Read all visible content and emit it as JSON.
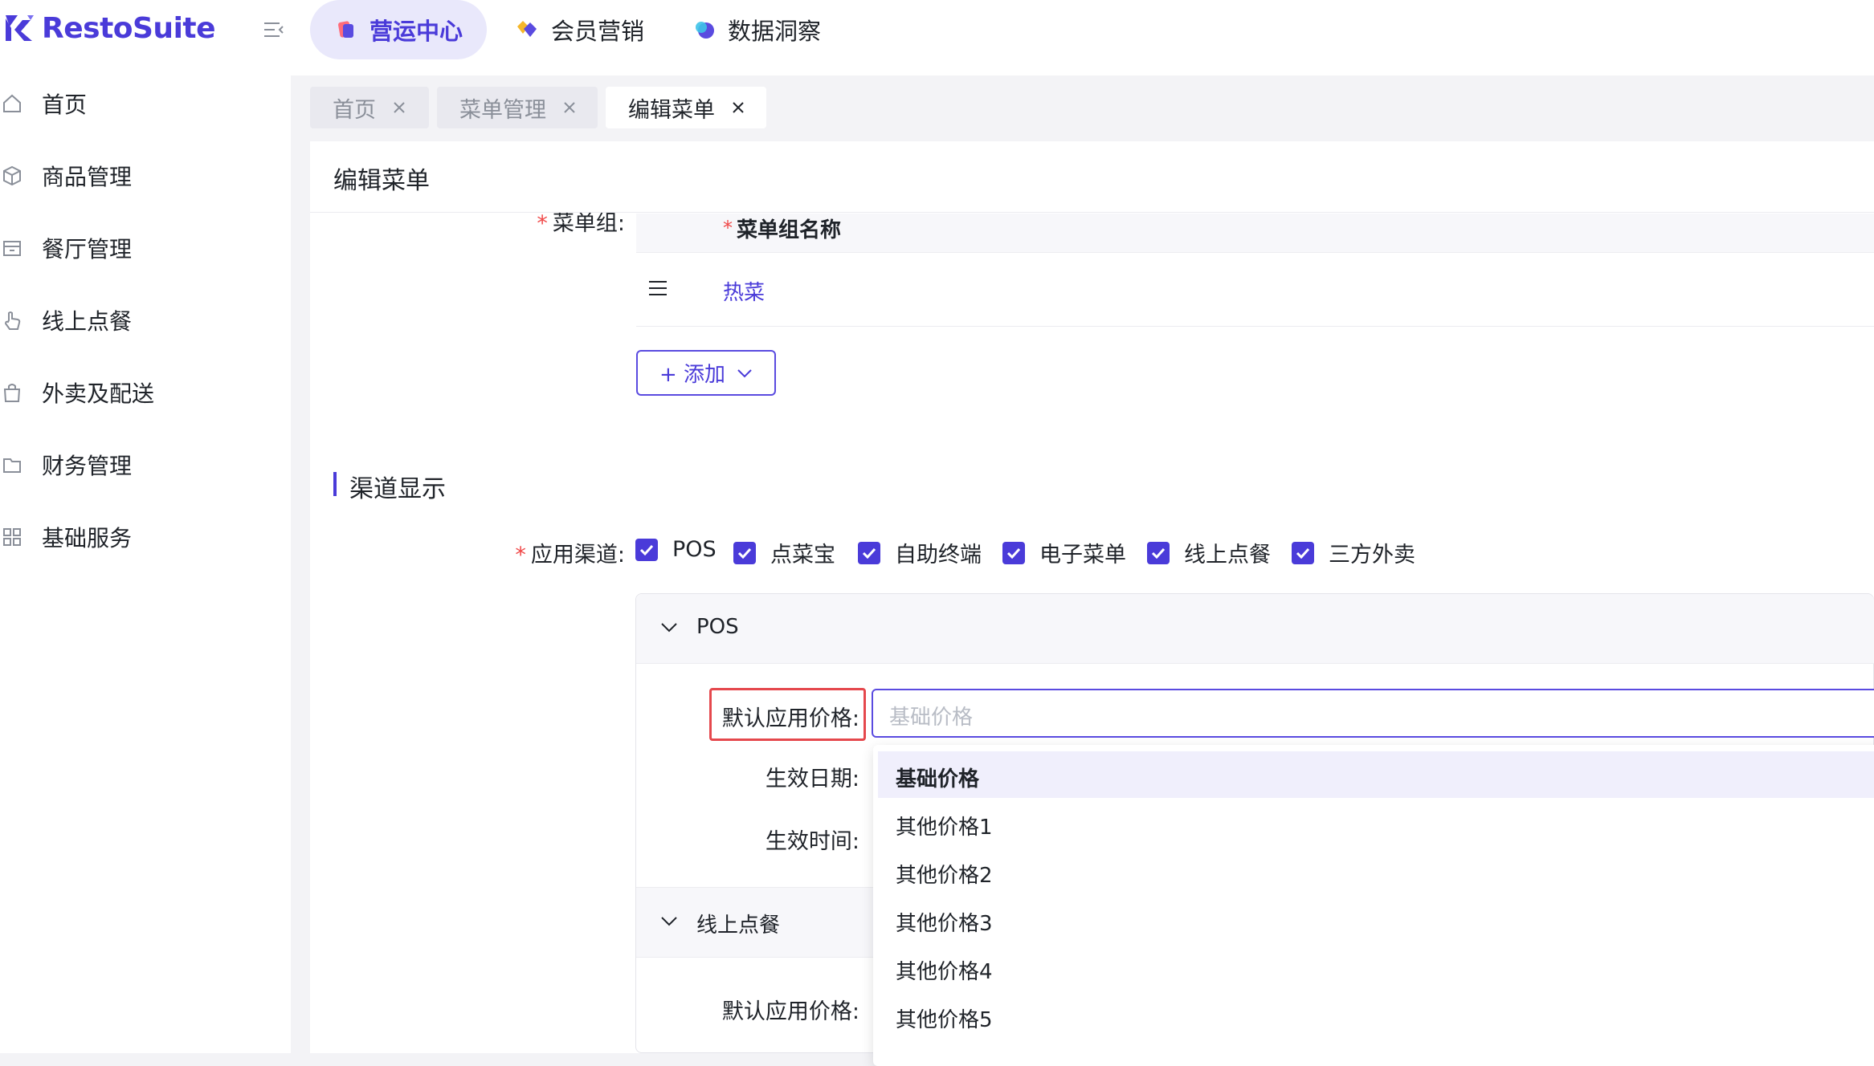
{
  "brand": {
    "name": "RestoSuite"
  },
  "top_nav": [
    {
      "label": "营运中心",
      "active": true
    },
    {
      "label": "会员营销",
      "active": false
    },
    {
      "label": "数据洞察",
      "active": false
    }
  ],
  "sidebar": {
    "items": [
      {
        "label": "首页",
        "icon": "home-icon"
      },
      {
        "label": "商品管理",
        "icon": "cube-icon"
      },
      {
        "label": "餐厅管理",
        "icon": "store-icon"
      },
      {
        "label": "线上点餐",
        "icon": "hand-pointer-icon"
      },
      {
        "label": "外卖及配送",
        "icon": "shopping-bag-icon"
      },
      {
        "label": "财务管理",
        "icon": "folder-icon"
      },
      {
        "label": "基础服务",
        "icon": "grid-icon"
      }
    ]
  },
  "tabs": [
    {
      "label": "首页",
      "active": false
    },
    {
      "label": "菜单管理",
      "active": false
    },
    {
      "label": "编辑菜单",
      "active": true
    }
  ],
  "page": {
    "title": "编辑菜单"
  },
  "menu_group": {
    "label": "菜单组:",
    "column_header": "菜单组名称",
    "rows": [
      {
        "name": "热菜"
      }
    ],
    "add_button": "+ 添加"
  },
  "channel_section": {
    "title": "渠道显示",
    "channel_label": "应用渠道:",
    "channels": [
      {
        "label": "POS",
        "checked": true
      },
      {
        "label": "点菜宝",
        "checked": true
      },
      {
        "label": "自助终端",
        "checked": true
      },
      {
        "label": "电子菜单",
        "checked": true
      },
      {
        "label": "线上点餐",
        "checked": true
      },
      {
        "label": "三方外卖",
        "checked": true
      }
    ]
  },
  "pos_panel": {
    "title": "POS",
    "default_price_label": "默认应用价格:",
    "default_price_placeholder": "基础价格",
    "effective_date_label": "生效日期:",
    "effective_time_label": "生效时间:"
  },
  "online_panel": {
    "title": "线上点餐",
    "default_price_label": "默认应用价格:"
  },
  "price_dropdown": {
    "options": [
      {
        "label": "基础价格",
        "selected": true
      },
      {
        "label": "其他价格1",
        "selected": false
      },
      {
        "label": "其他价格2",
        "selected": false
      },
      {
        "label": "其他价格3",
        "selected": false
      },
      {
        "label": "其他价格4",
        "selected": false
      },
      {
        "label": "其他价格5",
        "selected": false
      }
    ]
  },
  "colors": {
    "accent": "#4a3bd9",
    "required": "#f04848",
    "highlight": "#e5484d",
    "page_bg": "#f3f3f6"
  }
}
